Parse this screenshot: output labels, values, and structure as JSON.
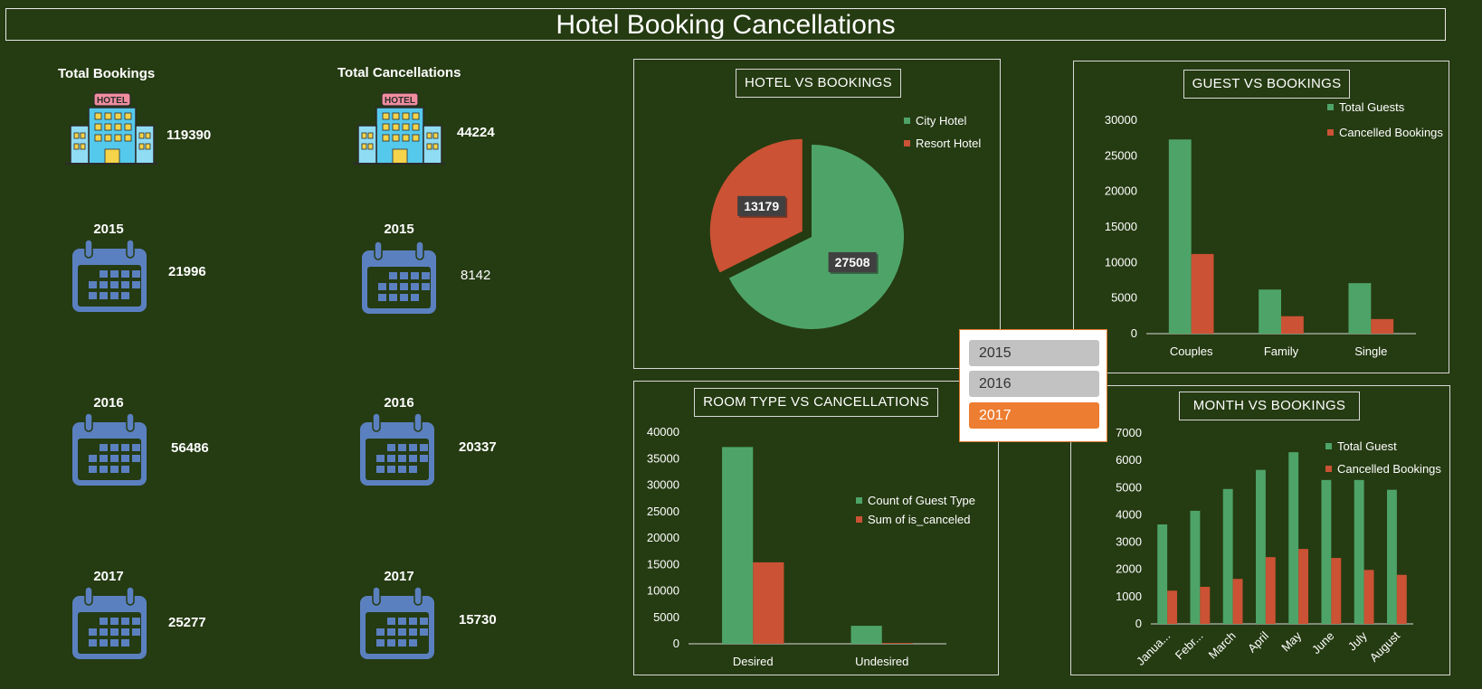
{
  "title": "Hotel Booking Cancellations",
  "kpis": {
    "bookings": {
      "label": "Total Bookings",
      "total": "119390",
      "years": [
        {
          "year": "2015",
          "value": "21996"
        },
        {
          "year": "2016",
          "value": "56486"
        },
        {
          "year": "2017",
          "value": "25277"
        }
      ]
    },
    "cancellations": {
      "label": "Total Cancellations",
      "total": "44224",
      "years": [
        {
          "year": "2015",
          "value": "8142"
        },
        {
          "year": "2016",
          "value": "20337"
        },
        {
          "year": "2017",
          "value": "15730"
        }
      ]
    },
    "hotel_sign": "HOTEL"
  },
  "icons": {
    "hotel": "hotel-building-icon",
    "calendar": "calendar-icon"
  },
  "slicer": {
    "items": [
      "2015",
      "2016",
      "2017"
    ],
    "selected": "2017"
  },
  "colors": {
    "background": "#253b12",
    "green": "#4ea468",
    "red": "#cb5234",
    "slicer_active": "#ed7d31"
  },
  "chart_data": [
    {
      "id": "hotel",
      "type": "pie",
      "title": "HOTEL VS BOOKINGS",
      "labels": [
        "City Hotel",
        "Resort Hotel"
      ],
      "values": [
        27508,
        13179
      ],
      "data_labels": [
        "27508",
        "13179"
      ],
      "legend": "top-right"
    },
    {
      "id": "guest",
      "type": "bar",
      "title": "GUEST VS BOOKINGS",
      "categories": [
        "Couples",
        "Family",
        "Single"
      ],
      "series": [
        {
          "name": "Total Guests",
          "values": [
            27300,
            6200,
            7100
          ]
        },
        {
          "name": "Cancelled Bookings",
          "values": [
            11200,
            2450,
            2050
          ]
        }
      ],
      "ylim": [
        0,
        30000
      ],
      "yticks": [
        "0",
        "5000",
        "10000",
        "15000",
        "20000",
        "25000",
        "30000"
      ],
      "legend": "top-right"
    },
    {
      "id": "room",
      "type": "bar",
      "title": "ROOM TYPE VS CANCELLATIONS",
      "categories": [
        "Desired",
        "Undesired"
      ],
      "series": [
        {
          "name": "Count of Guest Type",
          "values": [
            37200,
            3400
          ]
        },
        {
          "name": "Sum of is_canceled",
          "values": [
            15400,
            150
          ]
        }
      ],
      "ylim": [
        0,
        40000
      ],
      "yticks": [
        "0",
        "5000",
        "10000",
        "15000",
        "20000",
        "25000",
        "30000",
        "35000",
        "40000"
      ],
      "legend": "right"
    },
    {
      "id": "month",
      "type": "bar",
      "title": "MONTH VS BOOKINGS",
      "categories": [
        "Janua...",
        "Febr...",
        "March",
        "April",
        "May",
        "June",
        "July",
        "August"
      ],
      "series": [
        {
          "name": "Total Guest",
          "values": [
            3650,
            4150,
            4950,
            5650,
            6300,
            5280,
            5280,
            4920
          ]
        },
        {
          "name": "Cancelled Bookings",
          "values": [
            1220,
            1360,
            1650,
            2450,
            2750,
            2420,
            1980,
            1800
          ]
        }
      ],
      "ylim": [
        0,
        7000
      ],
      "yticks": [
        "0",
        "1000",
        "2000",
        "3000",
        "4000",
        "5000",
        "6000",
        "7000"
      ],
      "legend": "top-right"
    }
  ]
}
